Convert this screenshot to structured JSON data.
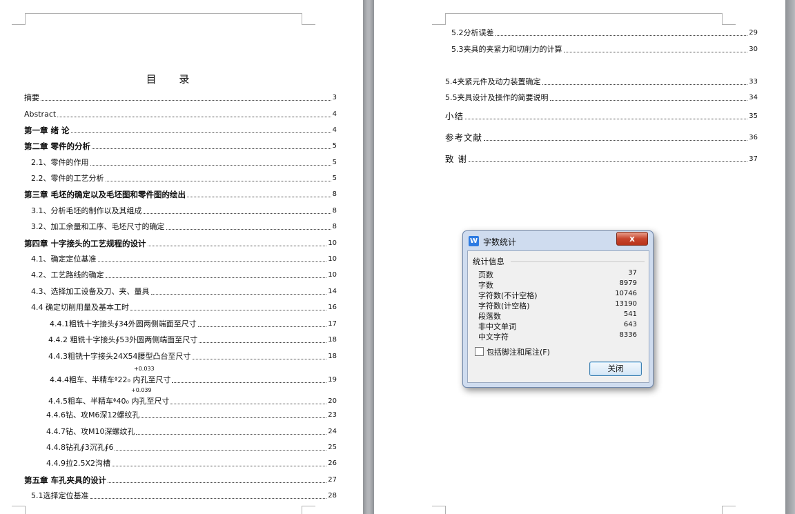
{
  "document": {
    "toc_title": "目  录",
    "left_entries": [
      {
        "label": "摘要",
        "page": "3"
      },
      {
        "label": "Abstract",
        "page": "4"
      },
      {
        "label": "第一章  绪  论",
        "page": "4"
      },
      {
        "label": "第二章  零件的分析",
        "page": "5"
      },
      {
        "label": "2.1、零件的作用",
        "page": "5"
      },
      {
        "label": "2.2、零件的工艺分析",
        "page": "5"
      },
      {
        "label": "第三章  毛坯的确定以及毛坯图和零件图的绘出",
        "page": "8"
      },
      {
        "label": "3.1、分析毛坯的制作以及其组成",
        "page": "8"
      },
      {
        "label": "3.2、加工余量和工序、毛坯尺寸的确定",
        "page": "8"
      },
      {
        "label": "第四章  十字接头的工艺规程的设计",
        "page": "10"
      },
      {
        "label": "4.1、确定定位基准",
        "page": "10"
      },
      {
        "label": "4.2、工艺路线的确定",
        "page": "10"
      },
      {
        "label": "4.3、选择加工设备及刀、夹、量具",
        "page": "14"
      },
      {
        "label": "4.4  确定切削用量及基本工时",
        "page": "16"
      },
      {
        "label": "4.4.1粗铣十字接头∮34外圆两侧端面至尺寸",
        "page": "17"
      },
      {
        "label": "4.4.2 粗铣十字接头∮53外圆两侧端面至尺寸",
        "page": "18"
      },
      {
        "label": "4.4.3粗铣十字接头24X54腰型凸台至尺寸",
        "page": "18"
      },
      {
        "label": "4.4.4粗车、半精车ᶲ22₀      内孔至尺寸",
        "page": "19"
      },
      {
        "label": "4.4.5粗车、半精车ᶲ40₀      内孔至尺寸",
        "page": "20"
      },
      {
        "label": "4.4.6钻、攻M6深12螺纹孔",
        "page": "23"
      },
      {
        "label": "4.4.7钻、攻M10深螺纹孔",
        "page": "24"
      },
      {
        "label": "4.4.8钻孔∮3沉孔∮6",
        "page": "25"
      },
      {
        "label": "4.4.9拉2.5X2沟槽",
        "page": "26"
      },
      {
        "label": "第五章  车孔夹具的设计",
        "page": "27"
      },
      {
        "label": "5.1选择定位基准",
        "page": "28"
      }
    ],
    "sup_444": "+0.033",
    "sup_445": "+0.039",
    "right_entries": [
      {
        "label": "5.2分析误差",
        "page": "29"
      },
      {
        "label": "5.3夹具的夹紧力和切削力的计算",
        "page": "30"
      },
      {
        "label": "5.4夹紧元件及动力装置确定",
        "page": "33"
      },
      {
        "label": "5.5夹具设计及操作的简要说明",
        "page": "34"
      },
      {
        "label": "小结",
        "page": "35"
      },
      {
        "label": "参考文献",
        "page": "36"
      },
      {
        "label": "致      谢",
        "page": "37"
      }
    ]
  },
  "dialog": {
    "app_icon": "W",
    "title": "字数统计",
    "close_icon": "x",
    "group_label": "统计信息",
    "stats": [
      {
        "label": "页数",
        "value": "37"
      },
      {
        "label": "字数",
        "value": "8979"
      },
      {
        "label": "字符数(不计空格)",
        "value": "10746"
      },
      {
        "label": "字符数(计空格)",
        "value": "13190"
      },
      {
        "label": "段落数",
        "value": "541"
      },
      {
        "label": "非中文单词",
        "value": "643"
      },
      {
        "label": "中文字符",
        "value": "8336"
      }
    ],
    "checkbox_label": "包括脚注和尾注(F)",
    "checkbox_checked": false,
    "close_button": "关闭"
  }
}
